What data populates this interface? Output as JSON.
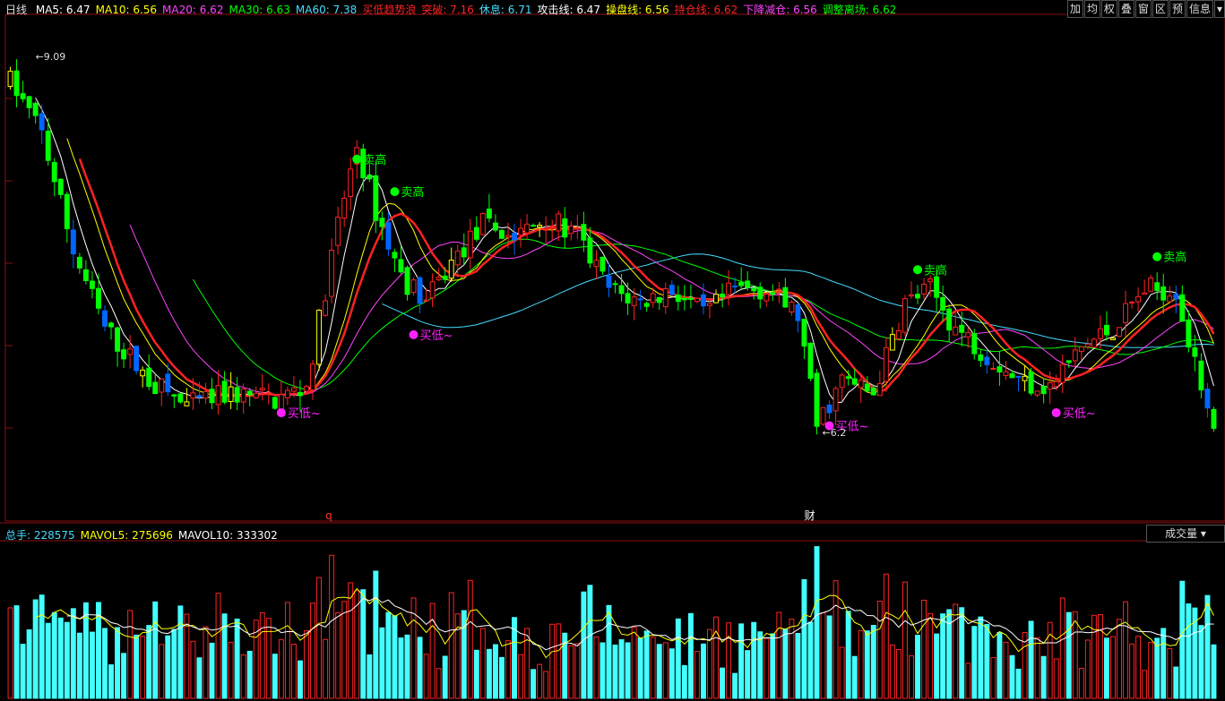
{
  "header": {
    "period": "日线",
    "items": [
      {
        "label": "MA5: 6.47",
        "color": "#ffffff"
      },
      {
        "label": "MA10: 6.56",
        "color": "#ffff00"
      },
      {
        "label": "MA20: 6.62",
        "color": "#ff44ff"
      },
      {
        "label": "MA30: 6.63",
        "color": "#00ff00"
      },
      {
        "label": "MA60: 7.38",
        "color": "#44ddff"
      },
      {
        "label": "买低趋势浪",
        "color": "#ff2222"
      },
      {
        "label": "突破: 7.16",
        "color": "#ff2222"
      },
      {
        "label": "休息: 6.71",
        "color": "#44ddff"
      },
      {
        "label": "攻击线: 6.47",
        "color": "#ffffff"
      },
      {
        "label": "操盘线: 6.56",
        "color": "#ffff00"
      },
      {
        "label": "持仓线: 6.62",
        "color": "#ff2222"
      },
      {
        "label": "下降减仓: 6.56",
        "color": "#ff44ff"
      },
      {
        "label": "调整离场: 6.62",
        "color": "#00ff00"
      }
    ]
  },
  "toolbar": [
    "加",
    "均",
    "权",
    "叠",
    "窗",
    "区",
    "预",
    "信息",
    "▾"
  ],
  "volume_header": {
    "items": [
      {
        "label": "总手: 228575",
        "color": "#44ddff"
      },
      {
        "label": "MAVOL5: 275696",
        "color": "#ffff00"
      },
      {
        "label": "MAVOL10: 333302",
        "color": "#ffffff"
      }
    ],
    "selector": "成交量 ▾"
  },
  "chart_data": {
    "type": "candlestick",
    "price_range": [
      5.6,
      9.4
    ],
    "max_label": "9.09",
    "max_price": 9.09,
    "min_label": "6.2",
    "min_price": 6.2,
    "signals": [
      {
        "text": "卖高",
        "index": 55,
        "price": 8.3,
        "color": "#00ff00"
      },
      {
        "text": "卖高",
        "index": 61,
        "price": 8.05,
        "color": "#00ff00"
      },
      {
        "text": "卖高",
        "index": 144,
        "price": 7.45,
        "color": "#00ff00"
      },
      {
        "text": "卖高",
        "index": 182,
        "price": 7.55,
        "color": "#00ff00"
      },
      {
        "text": "买低~",
        "index": 64,
        "price": 6.95,
        "color": "#ff22ff"
      },
      {
        "text": "买低~",
        "index": 43,
        "price": 6.35,
        "color": "#ff22ff"
      },
      {
        "text": "买低~",
        "index": 130,
        "price": 6.25,
        "color": "#ff22ff"
      },
      {
        "text": "买低~",
        "index": 166,
        "price": 6.35,
        "color": "#ff22ff"
      }
    ],
    "markers": [
      {
        "text": "q",
        "index": 50,
        "color": "#ff3333"
      },
      {
        "text": "财",
        "index": 126,
        "color": "#ffffff"
      }
    ],
    "volume_range": [
      0,
      1000000
    ],
    "legend_position": "top-left"
  }
}
